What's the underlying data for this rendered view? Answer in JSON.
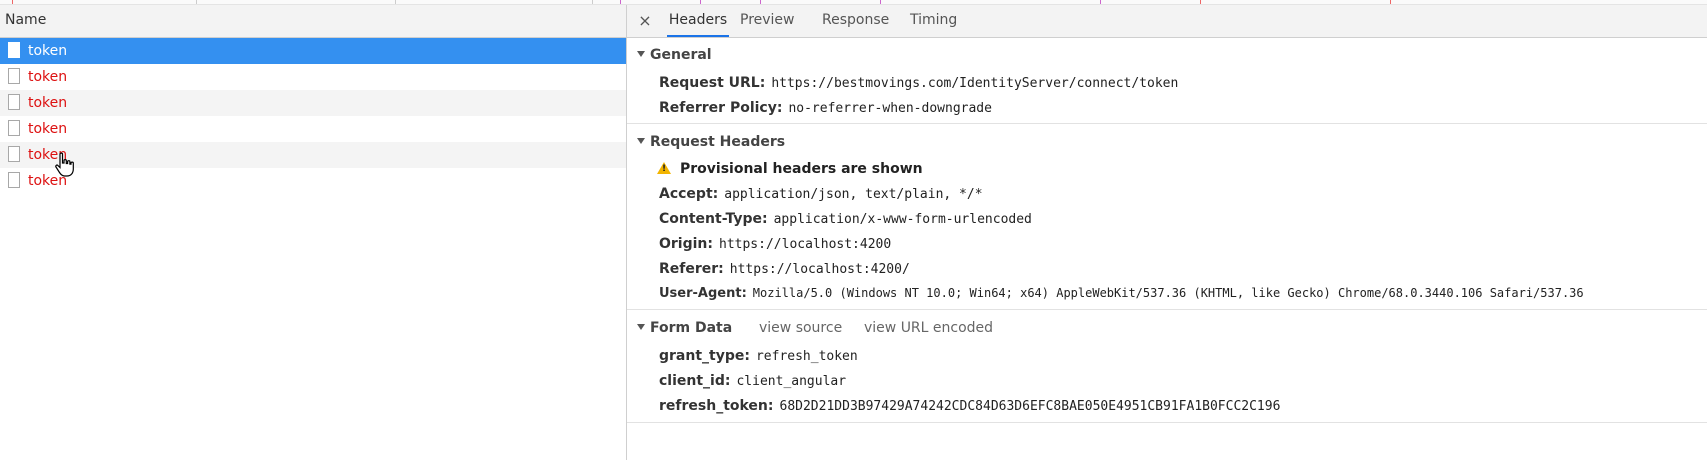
{
  "left_pane": {
    "column_header": "Name",
    "requests": [
      {
        "name": "token",
        "selected": true
      },
      {
        "name": "token",
        "selected": false
      },
      {
        "name": "token",
        "selected": false
      },
      {
        "name": "token",
        "selected": false
      },
      {
        "name": "token",
        "selected": false
      },
      {
        "name": "token",
        "selected": false
      }
    ]
  },
  "right_pane": {
    "close_symbol": "×",
    "tabs": [
      {
        "label": "Headers",
        "active": true
      },
      {
        "label": "Preview",
        "active": false
      },
      {
        "label": "Response",
        "active": false
      },
      {
        "label": "Timing",
        "active": false
      }
    ],
    "general": {
      "title": "General",
      "fields": [
        {
          "key": "Request URL:",
          "value": "https://bestmovings.com/IdentityServer/connect/token"
        },
        {
          "key": "Referrer Policy:",
          "value": "no-referrer-when-downgrade"
        }
      ]
    },
    "request_headers": {
      "title": "Request Headers",
      "warning": "Provisional headers are shown",
      "fields": [
        {
          "key": "Accept:",
          "value": "application/json, text/plain, */*"
        },
        {
          "key": "Content-Type:",
          "value": "application/x-www-form-urlencoded"
        },
        {
          "key": "Origin:",
          "value": "https://localhost:4200"
        },
        {
          "key": "Referer:",
          "value": "https://localhost:4200/"
        },
        {
          "key": "User-Agent:",
          "value": "Mozilla/5.0 (Windows NT 10.0; Win64; x64) AppleWebKit/537.36 (KHTML, like Gecko) Chrome/68.0.3440.106 Safari/537.36"
        }
      ]
    },
    "form_data": {
      "title": "Form Data",
      "view_source": "view source",
      "view_url_encoded": "view URL encoded",
      "fields": [
        {
          "key": "grant_type:",
          "value": "refresh_token"
        },
        {
          "key": "client_id:",
          "value": "client_angular"
        },
        {
          "key": "refresh_token:",
          "value": "68D2D21DD3B97429A74242CDC84D63D6EFC8BAE050E4951CB91FA1B0FCC2C196"
        }
      ]
    }
  },
  "colors": {
    "selected_row": "#3490f0",
    "error_text": "#dd1111",
    "active_tab_underline": "#1a73e8",
    "warning_icon": "#f2b400"
  }
}
